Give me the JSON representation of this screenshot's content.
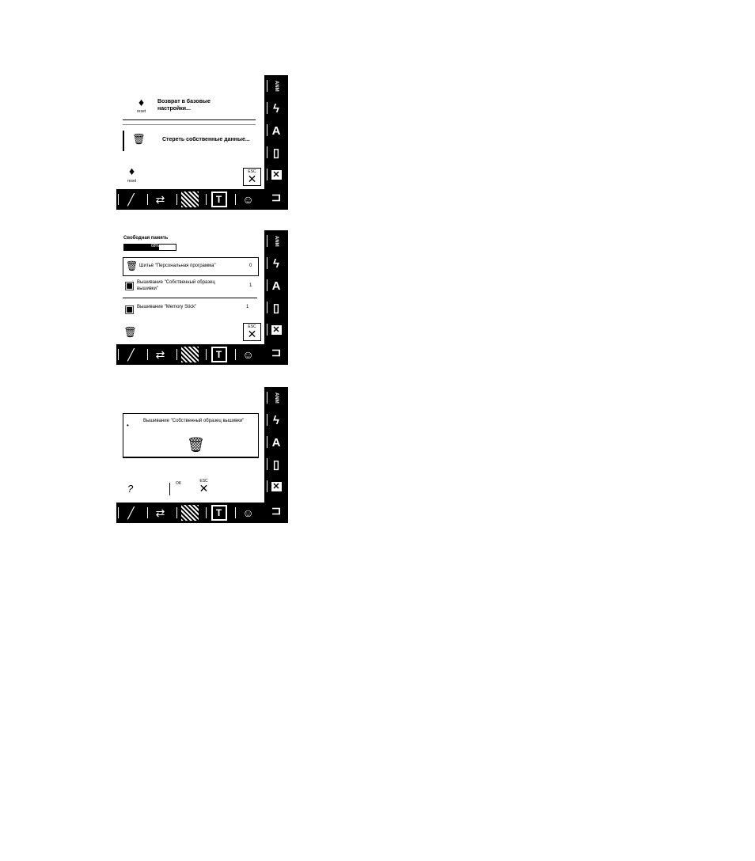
{
  "sidebar": {
    "top_label": "ANM",
    "stitch_icon": "zigzag-icon",
    "alphabet_label": "A",
    "buttonhole_label": "0",
    "exit_icon": "close-icon",
    "presser_icon": "presser-foot-icon"
  },
  "bottombar": {
    "needle_icon": "needle-icon",
    "arrow_icon": "arrow-icon",
    "embroidery_icon": "embroidery-icon",
    "tshirt_label": "T",
    "smiley_label": "☺"
  },
  "screen1": {
    "reset_label": "Возврат в базовые настройки...",
    "reset_caption": "reset",
    "delete_label": "Стереть собственные данные...",
    "bottom_reset_caption": "reset",
    "esc_label": "ESC"
  },
  "screen2": {
    "title": "Свободная память",
    "progress_text": "68%",
    "progress_value": 0.68,
    "rows": [
      {
        "label": "Шитьё \"Персональная программа\"",
        "value": "0"
      },
      {
        "label": "Вышивание \"Собственный образец вышивки\"",
        "value": "1"
      },
      {
        "label": "Вышивание \"Memory Stick\"",
        "value": "1 "
      }
    ],
    "esc_label": "ESC"
  },
  "screen3": {
    "message": "Вышивание \"Собственный образец вышивки\"",
    "ok_label": "OK",
    "esc_label": "ESC",
    "help_label": "?"
  },
  "colors": {
    "bar": "#000000",
    "screen": "#ffffff"
  }
}
